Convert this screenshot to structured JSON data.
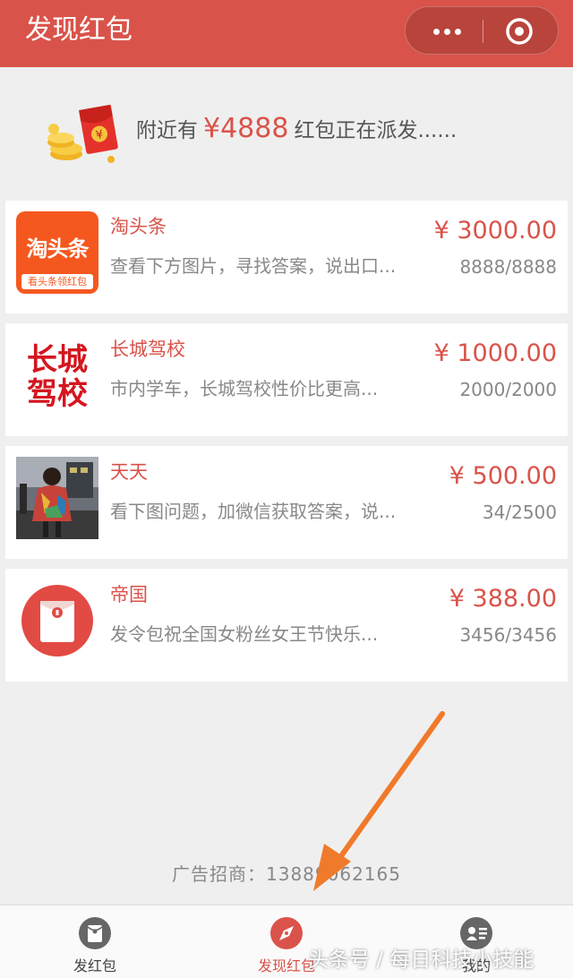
{
  "header": {
    "title": "发现红包",
    "accent": "#d9534a"
  },
  "banner": {
    "prefix": "附近有",
    "amount": "¥4888",
    "suffix": "红包正在派发......"
  },
  "cards": [
    {
      "name": "淘头条",
      "desc": "查看下方图片，寻找答案，说出口...",
      "price": "¥ 3000.00",
      "count": "8888/8888",
      "logo_main": "淘头条",
      "logo_sub": "看头条领红包"
    },
    {
      "name": "长城驾校",
      "desc": "市内学车，长城驾校性价比更高...",
      "price": "¥ 1000.00",
      "count": "2000/2000",
      "logo_line1": "长城",
      "logo_line2": "驾校"
    },
    {
      "name": "天天",
      "desc": "看下图问题，加微信获取答案，说...",
      "price": "¥ 500.00",
      "count": "34/2500"
    },
    {
      "name": "帝国",
      "desc": "发令包祝全国女粉丝女王节快乐...",
      "price": "¥ 388.00",
      "count": "3456/3456"
    }
  ],
  "ad": {
    "text": "广告招商：13889062165"
  },
  "tabs": [
    {
      "label": "发红包",
      "icon": "red-packet-icon"
    },
    {
      "label": "发现红包",
      "icon": "compass-icon"
    },
    {
      "label": "我的",
      "icon": "profile-card-icon"
    }
  ],
  "watermark": "头条号 / 每日科技小技能"
}
